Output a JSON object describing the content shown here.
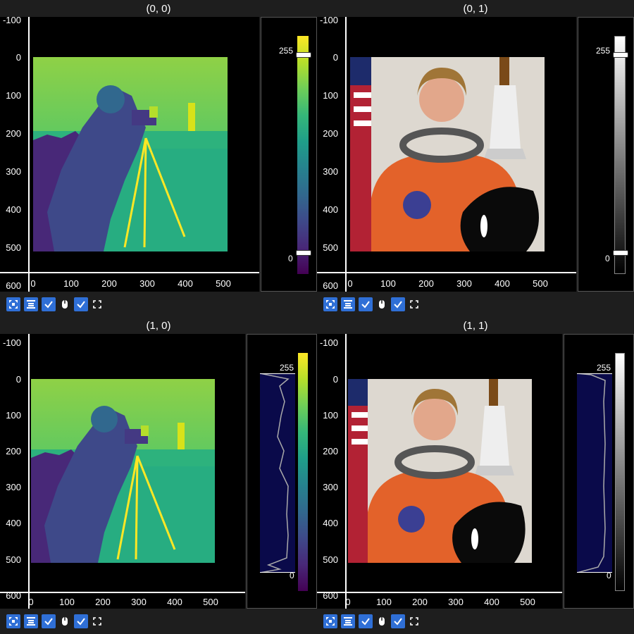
{
  "panels": [
    {
      "title": "(0, 0)",
      "image": "camera-viridis",
      "colormap": "viridis",
      "colorbar_mode": "slider",
      "cbar_labels": {
        "max": "255",
        "min": "0"
      }
    },
    {
      "title": "(0, 1)",
      "image": "astronaut-rgb",
      "colormap": "gray",
      "colorbar_mode": "slider",
      "cbar_labels": {
        "max": "255",
        "min": "0"
      }
    },
    {
      "title": "(1, 0)",
      "image": "camera-viridis",
      "colormap": "viridis",
      "colorbar_mode": "histogram",
      "cbar_labels": {
        "max": "255",
        "min": "0"
      }
    },
    {
      "title": "(1, 1)",
      "image": "astronaut-rgb",
      "colormap": "gray",
      "colorbar_mode": "histogram",
      "cbar_labels": {
        "max": "255",
        "min": "0"
      }
    }
  ],
  "y_ticks": [
    "-100",
    "0",
    "100",
    "200",
    "300",
    "400",
    "500",
    "600"
  ],
  "x_ticks": [
    "0",
    "100",
    "200",
    "300",
    "400",
    "500"
  ],
  "toolbar": {
    "buttons": [
      "auto-range-icon",
      "align-icon",
      "checkbox-mouse",
      "checkbox-fullscreen"
    ]
  },
  "colors": {
    "background": "#1e1e1e",
    "accent": "#2f6fd6",
    "hist_fill": "#0a0a4a"
  }
}
